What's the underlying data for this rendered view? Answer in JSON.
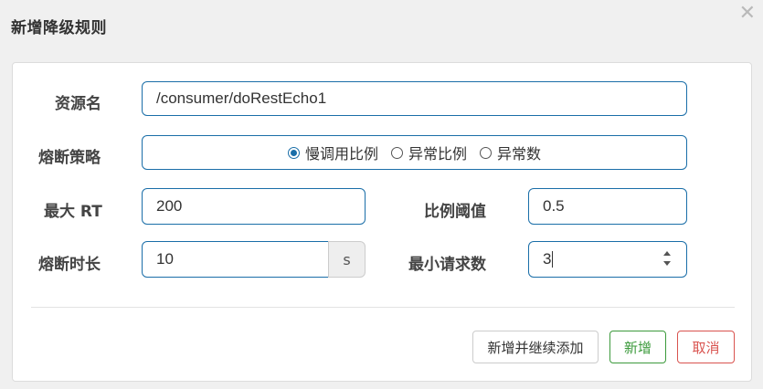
{
  "dialog": {
    "title": "新增降级规则",
    "close_icon": "close-icon"
  },
  "form": {
    "resource": {
      "label": "资源名",
      "value": "/consumer/doRestEcho1"
    },
    "strategy": {
      "label": "熔断策略",
      "options": [
        "慢调用比例",
        "异常比例",
        "异常数"
      ],
      "selected": "慢调用比例"
    },
    "max_rt": {
      "label": "最大 RT",
      "value": "200"
    },
    "ratio_threshold": {
      "label": "比例阈值",
      "value": "0.5"
    },
    "duration": {
      "label": "熔断时长",
      "value": "10",
      "unit": "s"
    },
    "min_requests": {
      "label": "最小请求数",
      "value": "3"
    }
  },
  "buttons": {
    "add_continue": "新增并继续添加",
    "add": "新增",
    "cancel": "取消"
  },
  "colors": {
    "accent": "#1a6ea8",
    "success": "#3c9a3c",
    "danger": "#d9534f"
  }
}
